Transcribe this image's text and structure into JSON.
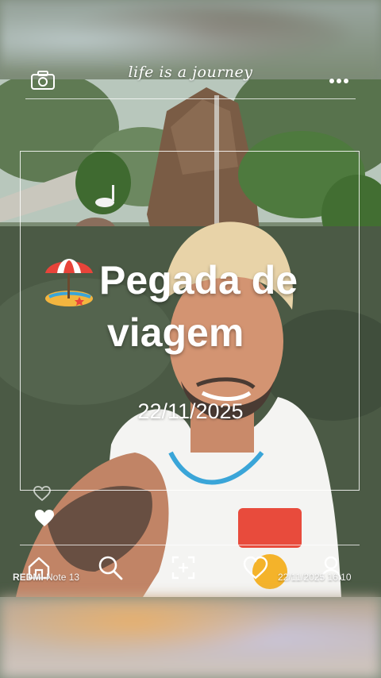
{
  "top_text": "life is a journey",
  "headline": {
    "line1": "Pegada de",
    "line2": "viagem"
  },
  "date": "22/11/2025",
  "watermark": {
    "brand": "REDMI",
    "model": "Note 13",
    "timestamp": "22/11/2025 16:10"
  },
  "icons": {
    "camera": "camera-icon",
    "more": "more-dots-icon",
    "umbrella": "beach-umbrella-icon",
    "heart_outline": "heart-outline-icon",
    "heart": "heart-icon",
    "home": "home-icon",
    "search": "search-icon",
    "add": "add-square-icon",
    "heart_nav": "heart-nav-icon",
    "profile": "profile-icon"
  },
  "colors": {
    "text": "#ffffff",
    "umbrella_red": "#e8443a",
    "sand": "#f3b53f"
  }
}
